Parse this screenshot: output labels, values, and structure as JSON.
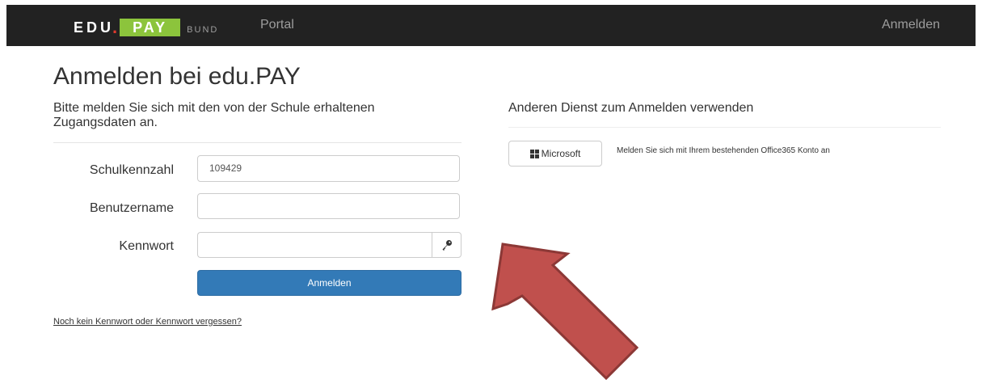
{
  "navbar": {
    "brand": {
      "part1": "EDU",
      "dot": ".",
      "part2": "PAY",
      "part3": "BUND"
    },
    "portal_label": "Portal",
    "login_label": "Anmelden"
  },
  "page": {
    "title": "Anmelden bei edu.PAY"
  },
  "login_form": {
    "intro": "Bitte melden Sie sich mit den von der Schule erhaltenen Zugangsdaten an.",
    "school_label": "Schulkennzahl",
    "school_value": "109429",
    "username_label": "Benutzername",
    "username_value": "",
    "password_label": "Kennwort",
    "password_value": "",
    "password_icon": "key-icon",
    "submit_label": "Anmelden",
    "forgot_link": "Noch kein Kennwort oder Kennwort vergessen?"
  },
  "alt_login": {
    "heading": "Anderen Dienst zum Anmelden verwenden",
    "microsoft_label": "Microsoft",
    "microsoft_icon": "windows-icon",
    "microsoft_description": "Melden Sie sich mit Ihrem bestehenden Office365 Konto an"
  },
  "annotation": {
    "icon": "arrow-icon",
    "color": "#c0504d"
  },
  "colors": {
    "navbar_bg": "#222222",
    "brand_green": "#8cc43c",
    "brand_red": "#e03a2e",
    "primary": "#337ab7"
  }
}
